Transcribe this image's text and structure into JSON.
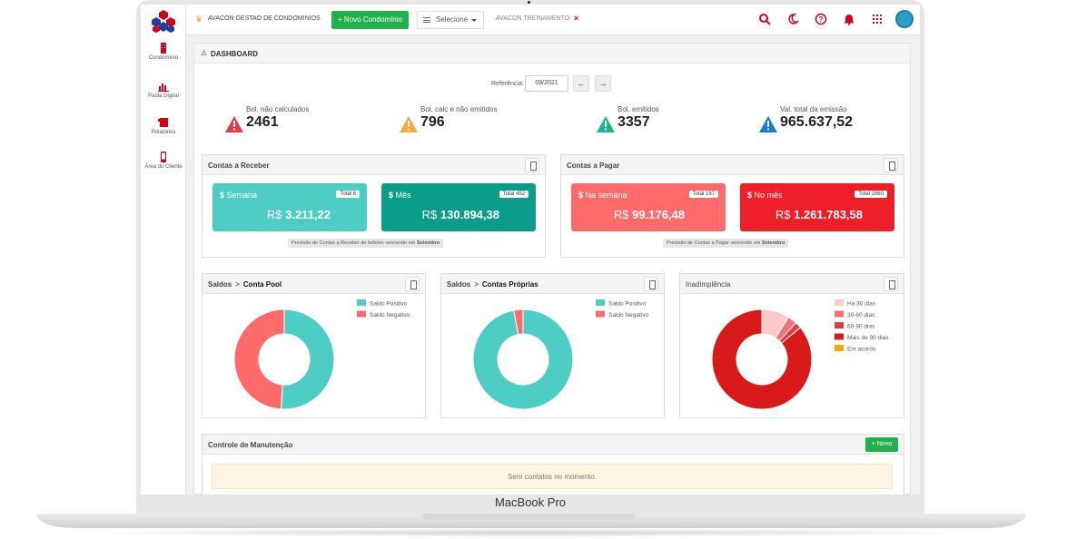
{
  "laptop": {
    "model_label": "MacBook Pro"
  },
  "sidebar": {
    "items": [
      {
        "label": "Condomínio",
        "icon": "building-icon"
      },
      {
        "label": "Pasta Digital",
        "icon": "bar-chart-icon"
      },
      {
        "label": "Relatórios",
        "icon": "report-icon"
      },
      {
        "label": "Área do Cliente",
        "icon": "mobile-icon"
      }
    ]
  },
  "topbar": {
    "title": "AVACON GESTAO DE CONDOMINIOS",
    "new_button": "+ Novo Condomínio",
    "select_label": "Selecione",
    "account": "AVACON TREINAMENTO",
    "close_mark": "×",
    "colors": {
      "icons": "#d0021b",
      "new_button": "#21b04b"
    }
  },
  "dashboard": {
    "title": "DASHBOARD",
    "reference_label": "Referência:",
    "reference_value": "09/2021",
    "prev_arrow": "←",
    "next_arrow": "→"
  },
  "stats": [
    {
      "label": "Bol. não calculados",
      "value": "2461",
      "color": "#e53950"
    },
    {
      "label": "Bol. calc e não emitidos",
      "value": "796",
      "color": "#f5a742"
    },
    {
      "label": "Bol. emitidos",
      "value": "3357",
      "color": "#1bb394"
    },
    {
      "label": "Val. total da emissão",
      "value": "965.637,52",
      "color": "#1a7bd0"
    }
  ],
  "receber": {
    "title": "Contas a Receber",
    "cards": [
      {
        "label": "Semana",
        "total": "Total 6",
        "currency": "R$",
        "value": "3.211,22",
        "color": "#4ecdc4"
      },
      {
        "label": "Mês",
        "total": "Total 452",
        "currency": "R$",
        "value": "130.894,38",
        "color": "#0b9c8a"
      }
    ],
    "note_text": "Previsão de Contas a Receber de boletos vencendo em ",
    "note_month": "Setembro"
  },
  "pagar": {
    "title": "Contas a Pagar",
    "cards": [
      {
        "label": "Na semana",
        "total": "Total 167",
        "currency": "R$",
        "value": "99.176,48",
        "color": "#ff6b6b"
      },
      {
        "label": "No mês",
        "total": "Total 1660",
        "currency": "R$",
        "value": "1.261.783,58",
        "color": "#ef1f2a"
      }
    ],
    "note_text": "Previsão de Contas a Pagar vencendo em ",
    "note_month": "Setembro"
  },
  "charts_panels": {
    "pool": {
      "prefix": "Saldos",
      "sep": ">",
      "title": "Conta Pool"
    },
    "proprias": {
      "prefix": "Saldos",
      "sep": ">",
      "title": "Contas Próprias"
    },
    "inad": {
      "title": "Inadimplência"
    }
  },
  "chart_data": [
    {
      "type": "pie",
      "title": "Conta Pool",
      "categories": [
        "Saldo Positivo",
        "Saldo Negativo"
      ],
      "values": [
        51,
        49
      ],
      "colors": [
        "#4ecdc4",
        "#ff6b6b"
      ],
      "legend": "top-right"
    },
    {
      "type": "pie",
      "title": "Contas Próprias",
      "categories": [
        "Saldo Positivo",
        "Saldo Negativo"
      ],
      "values": [
        97,
        3
      ],
      "colors": [
        "#4ecdc4",
        "#ff6b6b"
      ],
      "legend": "top-right"
    },
    {
      "type": "pie",
      "title": "Inadimplência",
      "categories": [
        "Ha 30 dias",
        "30-60 dias",
        "60-90 dias",
        "Mais de 90 dias",
        "Em acordo"
      ],
      "values": [
        9,
        3,
        2,
        86,
        0
      ],
      "colors": [
        "#ffc9c9",
        "#f17475",
        "#e53940",
        "#d81a1a",
        "#ffa500"
      ],
      "legend": "top-right"
    }
  ],
  "manutencao": {
    "title": "Controle de Manutenção",
    "new_button": "+ Novo",
    "empty_message": "Sem contatos no momento."
  }
}
